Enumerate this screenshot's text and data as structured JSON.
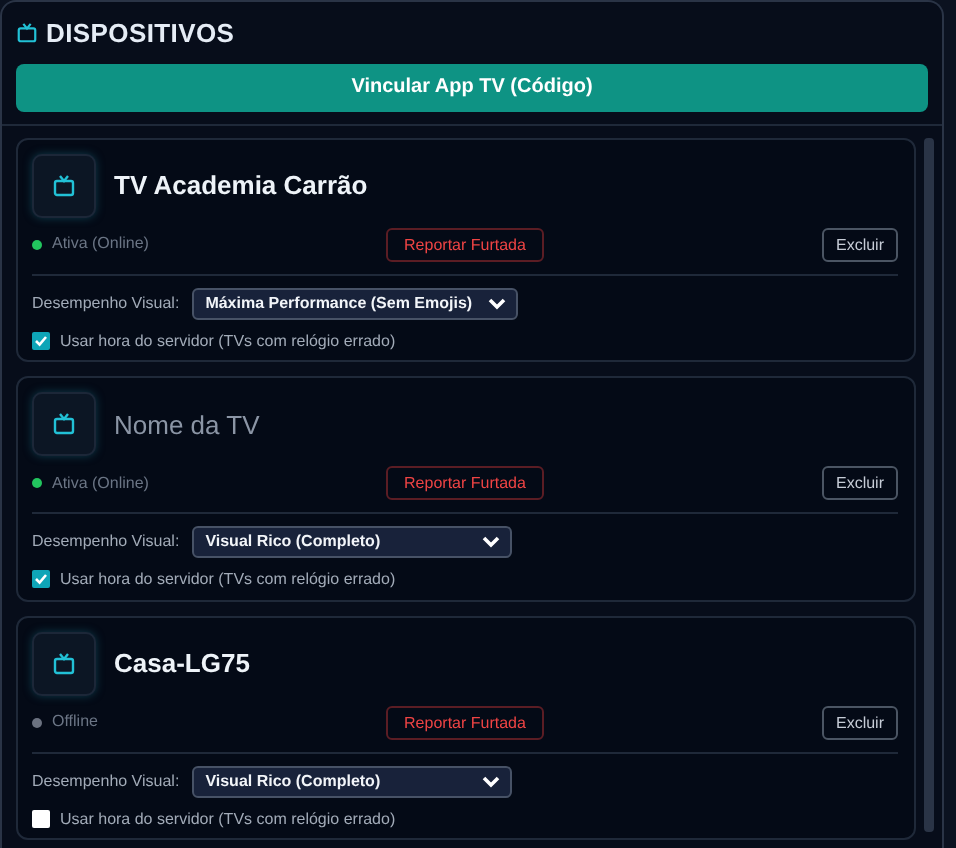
{
  "panel": {
    "title": "DISPOSITIVOS",
    "link_button": "Vincular App TV (Código)"
  },
  "devices": [
    {
      "name": "TV Academia Carrão",
      "online": true,
      "status": "Ativa (Online)",
      "report_button": "Reportar Furtada",
      "delete_button": "Excluir",
      "performance_label": "Desempenho Visual:",
      "performance_value": "Máxima Performance (Sem Emojis)",
      "server_time": {
        "label": "Usar hora do servidor (TVs com relógio errado)",
        "checked": true
      }
    },
    {
      "placeholder": "Nome da TV",
      "online": true,
      "status": "Ativa (Online)",
      "report_button": "Reportar Furtada",
      "delete_button": "Excluir",
      "performance_label": "Desempenho Visual:",
      "performance_value": "Visual Rico (Completo)",
      "server_time": {
        "label": "Usar hora do servidor (TVs com relógio errado)",
        "checked": true
      }
    },
    {
      "name": "Casa-LG75",
      "online": false,
      "status": "Offline",
      "report_button": "Reportar Furtada",
      "delete_button": "Excluir",
      "performance_label": "Desempenho Visual:",
      "performance_value": "Visual Rico (Completo)",
      "server_time": {
        "label": "Usar hora do servidor (TVs com relógio errado)",
        "checked": false
      }
    }
  ]
}
